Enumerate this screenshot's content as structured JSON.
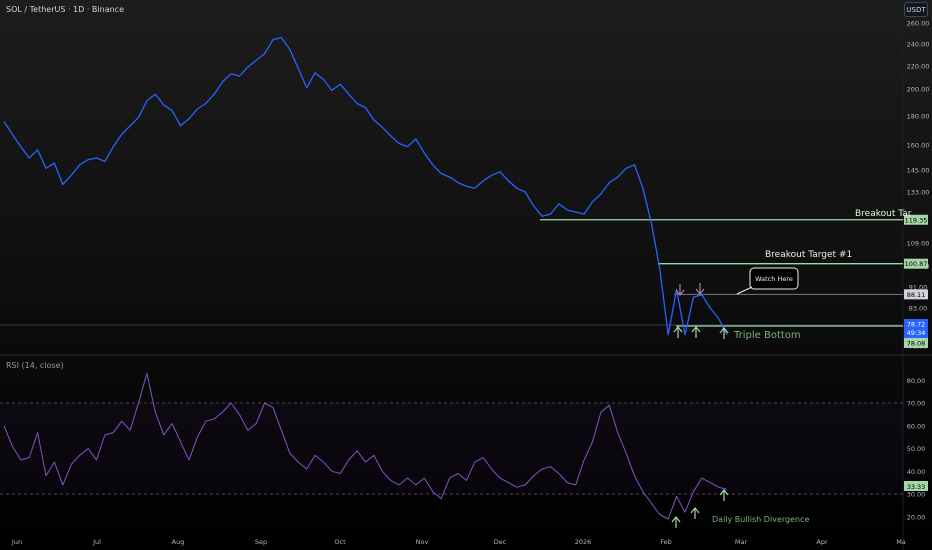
{
  "header": {
    "symbol_title": "SOL / TetherUS · 1D · Binance"
  },
  "currency_button": "USDT",
  "rsi_header": "RSI (14, close)",
  "colors": {
    "background": "#000000",
    "price_line": "#2962ff",
    "rsi_line": "#7e57c2",
    "level_line": "#a5d6a7",
    "resistance_line": "#787b86",
    "annotation": "#a5d6a7",
    "down_arrow": "#b57a9c"
  },
  "price_axis": {
    "ticks": [
      "260.00",
      "240.00",
      "220.00",
      "200.00",
      "180.00",
      "160.00",
      "145.00",
      "133.00",
      "109.00",
      "100.00",
      "91.00",
      "83.00",
      "76.00"
    ]
  },
  "price_badges": {
    "breakout_final": "119.35",
    "breakout_1": "100.87",
    "resistance": "88.11",
    "current_price": "78.72",
    "countdown": "49:34",
    "support": "78.08"
  },
  "rsi_axis": {
    "ticks": [
      "80.00",
      "70.00",
      "60.00",
      "50.00",
      "40.00",
      "30.00",
      "20.00"
    ]
  },
  "rsi_badge": "33.33",
  "time_axis": {
    "labels": [
      "Jun",
      "Jul",
      "Aug",
      "Sep",
      "Oct",
      "Nov",
      "Dec",
      "2026",
      "Feb",
      "Mar",
      "Apr",
      "Ma"
    ]
  },
  "annotations": {
    "breakout_final_label": "Breakout Tar",
    "breakout_1_label": "Breakout Target #1",
    "watch_here": "Watch Here",
    "triple_bottom": "Triple Bottom",
    "bullish_divergence": "Daily Bullish Divergence"
  },
  "chart_data": [
    {
      "type": "line",
      "title": "SOL / TetherUS · 1D · Binance",
      "x_labels": [
        "Jun",
        "Jul",
        "Aug",
        "Sep",
        "Oct",
        "Nov",
        "Dec",
        "2026",
        "Feb",
        "Mar",
        "Apr",
        "Ma"
      ],
      "y_scale": "log",
      "ylim": [
        76,
        260
      ],
      "series": [
        {
          "values": [
            176,
            167,
            159,
            152,
            157,
            146,
            149,
            137,
            142,
            148,
            151,
            152,
            150,
            159,
            167,
            173,
            179,
            191,
            196,
            188,
            184,
            173,
            178,
            185,
            189,
            196,
            206,
            213,
            211,
            219,
            225,
            231,
            244,
            246,
            235,
            218,
            201,
            214,
            208,
            199,
            204,
            196,
            189,
            186,
            177,
            172,
            166,
            161,
            159,
            164,
            155,
            148,
            143,
            141,
            138,
            136,
            135,
            139,
            142,
            144,
            139,
            135,
            133,
            126,
            121,
            122,
            127,
            124,
            123,
            122,
            128,
            132,
            138,
            141,
            146,
            148,
            135,
            118,
            99,
            78,
            90,
            78,
            87,
            88,
            83,
            81,
            78
          ]
        }
      ],
      "levels": [
        {
          "label": "Breakout Tar",
          "value": 119.35
        },
        {
          "label": "Breakout Target #1",
          "value": 100.87
        },
        {
          "label": "",
          "value": 88.11
        },
        {
          "label": "",
          "value": 78.08
        }
      ],
      "grid": false
    },
    {
      "type": "line",
      "title": "RSI (14, close)",
      "ylim": [
        15,
        85
      ],
      "series": [
        {
          "values": [
            60,
            51,
            45,
            46,
            57,
            38,
            44,
            34,
            43,
            47,
            50,
            45,
            56,
            57,
            62,
            58,
            70,
            83,
            66,
            56,
            61,
            53,
            45,
            55,
            62,
            63,
            66,
            70,
            65,
            58,
            61,
            70,
            68,
            58,
            48,
            44,
            41,
            47,
            44,
            40,
            39,
            45,
            49,
            44,
            47,
            40,
            36,
            34,
            37,
            34,
            37,
            31,
            28,
            37,
            39,
            36,
            44,
            46,
            41,
            37,
            35,
            33,
            34,
            38,
            41,
            42,
            39,
            35,
            34,
            45,
            53,
            66,
            69,
            57,
            48,
            38,
            31,
            26,
            21,
            19,
            29,
            22,
            31,
            37,
            35,
            33,
            32
          ]
        }
      ],
      "levels": [
        70,
        30
      ],
      "grid": false
    }
  ]
}
